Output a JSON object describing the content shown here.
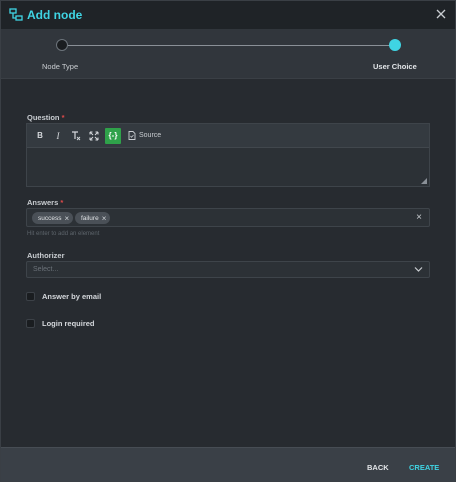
{
  "dialog": {
    "title": "Add node",
    "colors": {
      "accent": "#3fd4e3",
      "required": "#e04a4a",
      "variable_button": "#2fa24a"
    }
  },
  "stepper": {
    "steps": [
      {
        "label": "Node Type",
        "state": "completed"
      },
      {
        "label": "User Choice",
        "state": "active"
      }
    ]
  },
  "question": {
    "label": "Question",
    "required_mark": "*",
    "toolbar": {
      "bold": "B",
      "italic": "I",
      "remove_format": "Tx",
      "variable": "{-}",
      "source": "Source"
    },
    "value": ""
  },
  "answers": {
    "label": "Answers",
    "required_mark": "*",
    "tags": [
      "success",
      "failure"
    ],
    "clear": "×",
    "hint": "Hit enter to add an element"
  },
  "authorizer": {
    "label": "Authorizer",
    "placeholder": "Select..."
  },
  "options": {
    "answer_by_email": {
      "label": "Answer by email",
      "checked": false
    },
    "login_required": {
      "label": "Login required",
      "checked": false
    }
  },
  "footer": {
    "back_label": "BACK",
    "create_label": "CREATE"
  },
  "icons": {
    "title": "node-graph-icon",
    "close": "close-icon",
    "select": "chevron-down-icon",
    "source": "document-icon"
  }
}
